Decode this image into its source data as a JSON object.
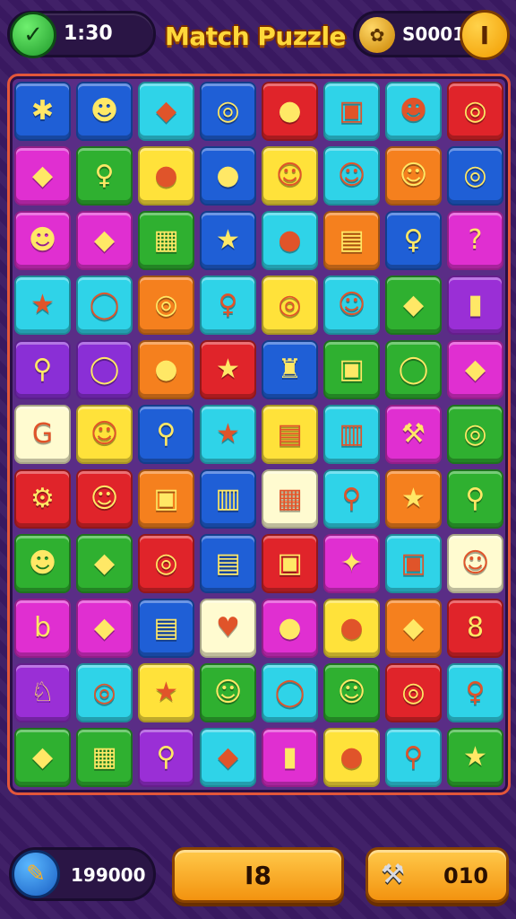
{
  "header": {
    "timer": "1:30",
    "title": "Match Puzzle",
    "coins": "S0001",
    "coin_badge": "I"
  },
  "board": {
    "rows": 11,
    "columns": 8,
    "tiles": [
      {
        "color": "#1f5fd6",
        "glyph": "✱",
        "icon": "splat-icon"
      },
      {
        "color": "#1f5fd6",
        "glyph": "☻",
        "icon": "red-blob-icon"
      },
      {
        "color": "#2fd3e8",
        "glyph": "◆",
        "icon": "green-block-icon"
      },
      {
        "color": "#1f5fd6",
        "glyph": "◎",
        "icon": "orange-ring-icon"
      },
      {
        "color": "#e0242a",
        "glyph": "●",
        "icon": "bubble-icon"
      },
      {
        "color": "#2fd3e8",
        "glyph": "▣",
        "icon": "purple-box-icon"
      },
      {
        "color": "#2fd3e8",
        "glyph": "☻",
        "icon": "red-monster-icon"
      },
      {
        "color": "#e0242a",
        "glyph": "◎",
        "icon": "ring-icon"
      },
      {
        "color": "#e02fd1",
        "glyph": "◆",
        "icon": "kite-icon"
      },
      {
        "color": "#2fb030",
        "glyph": "♀",
        "icon": "lollipop-icon"
      },
      {
        "color": "#ffe23a",
        "glyph": "●",
        "icon": "red-balloon-icon"
      },
      {
        "color": "#1f5fd6",
        "glyph": "●",
        "icon": "green-balloon-icon"
      },
      {
        "color": "#ffe23a",
        "glyph": "☺",
        "icon": "orange-face-icon"
      },
      {
        "color": "#2fd3e8",
        "glyph": "☺",
        "icon": "purple-face-icon"
      },
      {
        "color": "#f5801e",
        "glyph": "☺",
        "icon": "yellow-face-icon"
      },
      {
        "color": "#1f5fd6",
        "glyph": "◎",
        "icon": "target-icon"
      },
      {
        "color": "#e02fd1",
        "glyph": "☻",
        "icon": "skull-icon"
      },
      {
        "color": "#e02fd1",
        "glyph": "◆",
        "icon": "paper-plane-icon"
      },
      {
        "color": "#2fb030",
        "glyph": "▦",
        "icon": "calendar-icon"
      },
      {
        "color": "#1f5fd6",
        "glyph": "★",
        "icon": "star-icon"
      },
      {
        "color": "#2fd3e8",
        "glyph": "●",
        "icon": "green-bubble-icon"
      },
      {
        "color": "#f5801e",
        "glyph": "▤",
        "icon": "gift-box-icon"
      },
      {
        "color": "#1f5fd6",
        "glyph": "♀",
        "icon": "magnifier-icon"
      },
      {
        "color": "#e02fd1",
        "glyph": "?",
        "icon": "question-icon"
      },
      {
        "color": "#2fd3e8",
        "glyph": "★",
        "icon": "green-star-icon"
      },
      {
        "color": "#2fd3e8",
        "glyph": "◯",
        "icon": "bubble-ring-icon"
      },
      {
        "color": "#f5801e",
        "glyph": "◎",
        "icon": "swirl-icon"
      },
      {
        "color": "#2fd3e8",
        "glyph": "♀",
        "icon": "search-icon"
      },
      {
        "color": "#ffe23a",
        "glyph": "◎",
        "icon": "purple-ring-icon"
      },
      {
        "color": "#2fd3e8",
        "glyph": "☺",
        "icon": "yellow-blob-icon"
      },
      {
        "color": "#2fb030",
        "glyph": "◆",
        "icon": "leaf-icon"
      },
      {
        "color": "#9a2fd6",
        "glyph": "▮",
        "icon": "jar-icon"
      },
      {
        "color": "#8a2fd6",
        "glyph": "⚲",
        "icon": "wand-icon"
      },
      {
        "color": "#8a2fd6",
        "glyph": "◯",
        "icon": "violet-ring-icon"
      },
      {
        "color": "#f5801e",
        "glyph": "●",
        "icon": "blue-bubble-icon"
      },
      {
        "color": "#e0242a",
        "glyph": "★",
        "icon": "gold-star-icon"
      },
      {
        "color": "#1f5fd6",
        "glyph": "♜",
        "icon": "robot-icon"
      },
      {
        "color": "#2fb030",
        "glyph": "▣",
        "icon": "photo-icon"
      },
      {
        "color": "#2fb030",
        "glyph": "◯",
        "icon": "donut-icon"
      },
      {
        "color": "#e02fd1",
        "glyph": "◆",
        "icon": "flag-icon"
      },
      {
        "color": "#fffbd0",
        "glyph": "G",
        "icon": "letter-g-icon"
      },
      {
        "color": "#ffe23a",
        "glyph": "☺",
        "icon": "cookie-face-icon"
      },
      {
        "color": "#1f5fd6",
        "glyph": "⚲",
        "icon": "hook-icon"
      },
      {
        "color": "#2fd3e8",
        "glyph": "★",
        "icon": "magic-box-icon"
      },
      {
        "color": "#ffe23a",
        "glyph": "▤",
        "icon": "present-icon"
      },
      {
        "color": "#2fd3e8",
        "glyph": "▥",
        "icon": "basket-icon"
      },
      {
        "color": "#e02fd1",
        "glyph": "⚒",
        "icon": "hammer-icon"
      },
      {
        "color": "#2fb030",
        "glyph": "◎",
        "icon": "shield-icon"
      },
      {
        "color": "#e0242a",
        "glyph": "⚙",
        "icon": "gear-icon"
      },
      {
        "color": "#e0242a",
        "glyph": "☺",
        "icon": "orange-smile-icon"
      },
      {
        "color": "#f5801e",
        "glyph": "▣",
        "icon": "cube-icon"
      },
      {
        "color": "#1f5fd6",
        "glyph": "▥",
        "icon": "book-icon"
      },
      {
        "color": "#fffbd0",
        "glyph": "▦",
        "icon": "grid-icon"
      },
      {
        "color": "#2fd3e8",
        "glyph": "⚲",
        "icon": "mallet-icon"
      },
      {
        "color": "#f5801e",
        "glyph": "★",
        "icon": "green-splat-icon"
      },
      {
        "color": "#2fb030",
        "glyph": "⚲",
        "icon": "syringe-icon"
      },
      {
        "color": "#2fb030",
        "glyph": "☻",
        "icon": "yellow-monster-icon"
      },
      {
        "color": "#2fb030",
        "glyph": "◆",
        "icon": "feather-icon"
      },
      {
        "color": "#e0242a",
        "glyph": "◎",
        "icon": "power-icon"
      },
      {
        "color": "#1f5fd6",
        "glyph": "▤",
        "icon": "layers-icon"
      },
      {
        "color": "#e0242a",
        "glyph": "▣",
        "icon": "crate-icon"
      },
      {
        "color": "#e02fd1",
        "glyph": "✦",
        "icon": "sparkle-icon"
      },
      {
        "color": "#2fd3e8",
        "glyph": "▣",
        "icon": "dice-icon"
      },
      {
        "color": "#fffbd0",
        "glyph": "☺",
        "icon": "peach-face-icon"
      },
      {
        "color": "#e02fd1",
        "glyph": "b",
        "icon": "letter-b-icon"
      },
      {
        "color": "#e02fd1",
        "glyph": "◆",
        "icon": "shard-icon"
      },
      {
        "color": "#1f5fd6",
        "glyph": "▤",
        "icon": "list-icon"
      },
      {
        "color": "#fffbd0",
        "glyph": "♥",
        "icon": "heart-icon"
      },
      {
        "color": "#e02fd1",
        "glyph": "●",
        "icon": "apple-icon"
      },
      {
        "color": "#ffe23a",
        "glyph": "●",
        "icon": "cookie-icon"
      },
      {
        "color": "#f5801e",
        "glyph": "◆",
        "icon": "blue-flag-icon"
      },
      {
        "color": "#e0242a",
        "glyph": "8",
        "icon": "number-eight-icon"
      },
      {
        "color": "#9a2fd6",
        "glyph": "♘",
        "icon": "chess-icon"
      },
      {
        "color": "#2fd3e8",
        "glyph": "◎",
        "icon": "vortex-icon"
      },
      {
        "color": "#ffe23a",
        "glyph": "★",
        "icon": "blue-star-icon"
      },
      {
        "color": "#2fb030",
        "glyph": "☺",
        "icon": "pumpkin-icon"
      },
      {
        "color": "#2fd3e8",
        "glyph": "◯",
        "icon": "lens-icon"
      },
      {
        "color": "#2fb030",
        "glyph": "☺",
        "icon": "flame-face-icon"
      },
      {
        "color": "#e0242a",
        "glyph": "◎",
        "icon": "disc-icon"
      },
      {
        "color": "#2fd3e8",
        "glyph": "♀",
        "icon": "candy-icon"
      },
      {
        "color": "#2fb030",
        "glyph": "◆",
        "icon": "envelope-icon"
      },
      {
        "color": "#2fb030",
        "glyph": "▦",
        "icon": "abacus-icon"
      },
      {
        "color": "#9a2fd6",
        "glyph": "⚲",
        "icon": "pencil-icon"
      },
      {
        "color": "#2fd3e8",
        "glyph": "◆",
        "icon": "arrow-icon"
      },
      {
        "color": "#e02fd1",
        "glyph": "▮",
        "icon": "battery-icon"
      },
      {
        "color": "#ffe23a",
        "glyph": "●",
        "icon": "globe-icon"
      },
      {
        "color": "#2fd3e8",
        "glyph": "⚲",
        "icon": "popsicle-icon"
      },
      {
        "color": "#2fb030",
        "glyph": "★",
        "icon": "clover-icon"
      }
    ]
  },
  "footer": {
    "score": "199000",
    "moves": "I8",
    "hint_count": "010"
  }
}
